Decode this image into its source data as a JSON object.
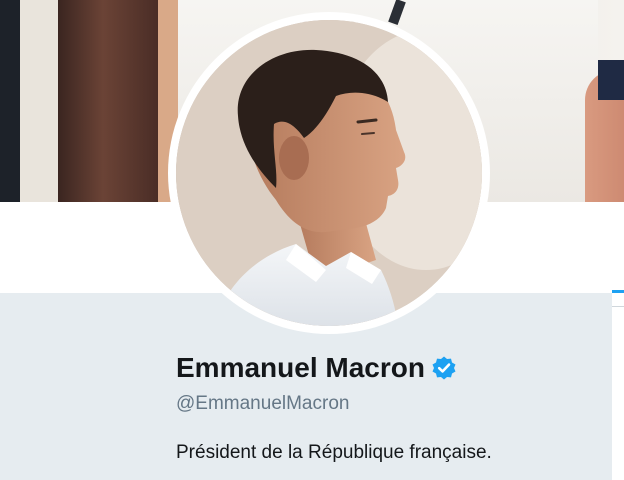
{
  "profile": {
    "display_name": "Emmanuel Macron",
    "handle": "@EmmanuelMacron",
    "bio": "Président de la République française.",
    "verified": true
  },
  "colors": {
    "accent": "#1da1f2",
    "card_background": "#e6ecf0",
    "name_text": "#14171a",
    "handle_text": "#657786"
  },
  "icons": {
    "verified": "verified-badge-icon"
  }
}
